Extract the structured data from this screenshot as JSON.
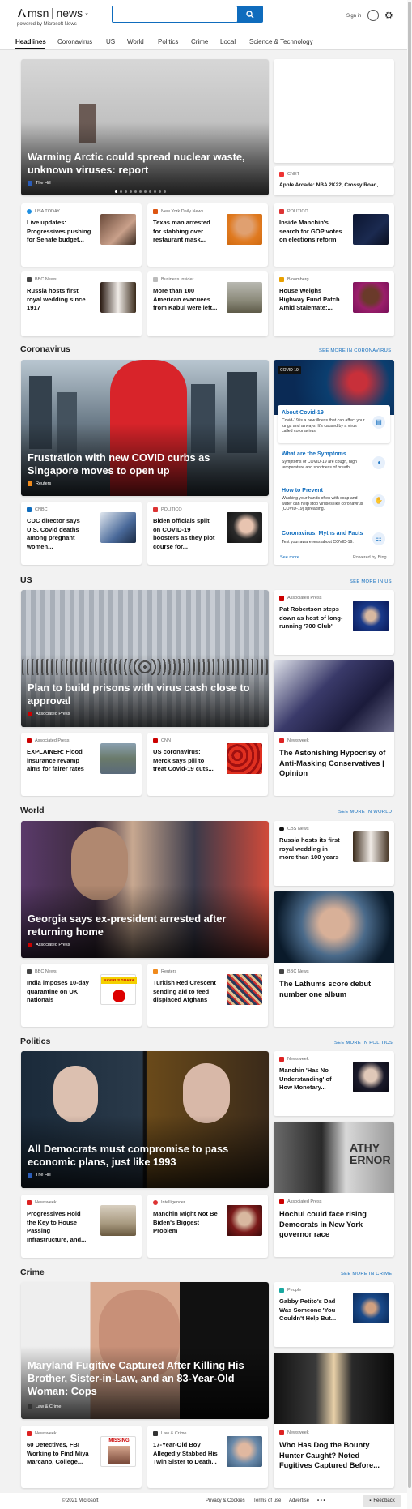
{
  "brand": {
    "logo": "msn",
    "app": "news",
    "powered": "powered by Microsoft News"
  },
  "header": {
    "signin": "Sign in"
  },
  "nav": [
    "Headlines",
    "Coronavirus",
    "US",
    "World",
    "Politics",
    "Crime",
    "Local",
    "Science & Technology"
  ],
  "top": {
    "hero": {
      "title": "Warming Arctic could spread nuclear waste, unknown viruses: report",
      "source": "The Hill"
    },
    "side": {
      "source": "CNET",
      "title": "Apple Arcade: NBA 2K22, Crossy Road,..."
    },
    "r1": [
      {
        "source": "USA TODAY",
        "title": "Live updates: Progressives pushing for Senate budget..."
      },
      {
        "source": "New York Daily News",
        "title": "Texas man arrested for stabbing over restaurant mask..."
      },
      {
        "source": "POLITICO",
        "title": "Inside Manchin's search for GOP votes on elections reform"
      }
    ],
    "r2": [
      {
        "source": "BBC News",
        "title": "Russia hosts first royal wedding since 1917"
      },
      {
        "source": "Business Insider",
        "title": "More than 100 American evacuees from Kabul were left..."
      },
      {
        "source": "Bloomberg",
        "title": "House Weighs Highway Fund Patch Amid Stalemate:..."
      }
    ]
  },
  "coronavirus": {
    "heading": "Coronavirus",
    "more": "SEE MORE IN CORONAVIRUS",
    "hero": {
      "title": "Frustration with new COVID curbs as Singapore moves to open up",
      "source": "Reuters"
    },
    "panel": {
      "badge": "COVID 19",
      "items": [
        {
          "title": "About Covid-19",
          "text": "Covid-19 is a new illness that can affect your lungs and airways. It's caused by a virus called coronavirus."
        },
        {
          "title": "What are the Symptoms",
          "text": "Symptoms of COVID-19 are cough, high temperature and shortness of breath."
        },
        {
          "title": "How to Prevent",
          "text": "Washing your hands often with soap and water can help stop viruses like coronavirus (COVID-19) spreading."
        },
        {
          "title": "Coronavirus: Myths and Facts",
          "text": "Test your awareness about COVID-19."
        }
      ],
      "see_more": "See more",
      "powered": "Powered by Bing"
    },
    "cards": [
      {
        "source": "CNBC",
        "title": "CDC director says U.S. Covid deaths among pregnant women..."
      },
      {
        "source": "POLITICO",
        "title": "Biden officials split on COVID-19 boosters as they plot course for..."
      }
    ]
  },
  "us": {
    "heading": "US",
    "more": "SEE MORE IN US",
    "hero": {
      "title": "Plan to build prisons with virus cash close to approval",
      "source": "Associated Press"
    },
    "side1": {
      "source": "Associated Press",
      "title": "Pat Robertson steps down as host of long-running '700 Club'"
    },
    "side2": {
      "source": "Newsweek",
      "title": "The Astonishing Hypocrisy of Anti-Masking Conservatives | Opinion"
    },
    "cards": [
      {
        "source": "Associated Press",
        "title": "EXPLAINER: Flood insurance revamp aims for fairer rates"
      },
      {
        "source": "CNN",
        "title": "US coronavirus: Merck says pill to treat Covid-19 cuts..."
      }
    ]
  },
  "world": {
    "heading": "World",
    "more": "SEE MORE IN WORLD",
    "hero": {
      "title": "Georgia says ex-president arrested after returning home",
      "source": "Associated Press"
    },
    "side1": {
      "source": "CBS News",
      "title": "Russia hosts its first royal wedding in more than 100 years"
    },
    "side2": {
      "source": "BBC News",
      "title": "The Lathums score debut number one album"
    },
    "cards": [
      {
        "source": "BBC News",
        "title": "India imposes 10-day quarantine on UK nationals",
        "thumb_text": "NAVIRUS GUARA"
      },
      {
        "source": "Reuters",
        "title": "Turkish Red Crescent sending aid to feed displaced Afghans"
      }
    ]
  },
  "politics": {
    "heading": "Politics",
    "more": "SEE MORE IN POLITICS",
    "hero": {
      "title": "All Democrats must compromise to pass economic plans, just like 1993",
      "source": "The Hill"
    },
    "side1": {
      "source": "Newsweek",
      "title": "Manchin 'Has No Understanding' of How Monetary..."
    },
    "side2": {
      "source": "Associated Press",
      "title": "Hochul could face rising Democrats in New York governor race",
      "photo_text": "ATHY ERNOR"
    },
    "cards": [
      {
        "source": "Newsweek",
        "title": "Progressives Hold the Key to House Passing Infrastructure, and..."
      },
      {
        "source": "Intelligencer",
        "title": "Manchin Might Not Be Biden's Biggest Problem"
      }
    ]
  },
  "crime": {
    "heading": "Crime",
    "more": "SEE MORE IN CRIME",
    "hero": {
      "title": "Maryland Fugitive Captured After Killing His Brother, Sister-in-Law, and an 83-Year-Old Woman: Cops",
      "source": "Law & Crime"
    },
    "side1": {
      "source": "People",
      "title": "Gabby Petito's Dad Was Someone 'You Couldn't Help But..."
    },
    "side2": {
      "source": "Newsweek",
      "title": "Who Has Dog the Bounty Hunter Caught? Noted Fugitives Captured Before..."
    },
    "cards": [
      {
        "source": "Newsweek",
        "title": "60 Detectives, FBI Working to Find Miya Marcano, College...",
        "thumb_text": "MISSING"
      },
      {
        "source": "Law & Crime",
        "title": "17-Year-Old Boy Allegedly Stabbed His Twin Sister to Death..."
      }
    ]
  },
  "footer": {
    "copyright": "© 2021 Microsoft",
    "links": [
      "Privacy & Cookies",
      "Terms of use",
      "Advertise"
    ],
    "more": "• • •",
    "feedback": "Feedback"
  }
}
